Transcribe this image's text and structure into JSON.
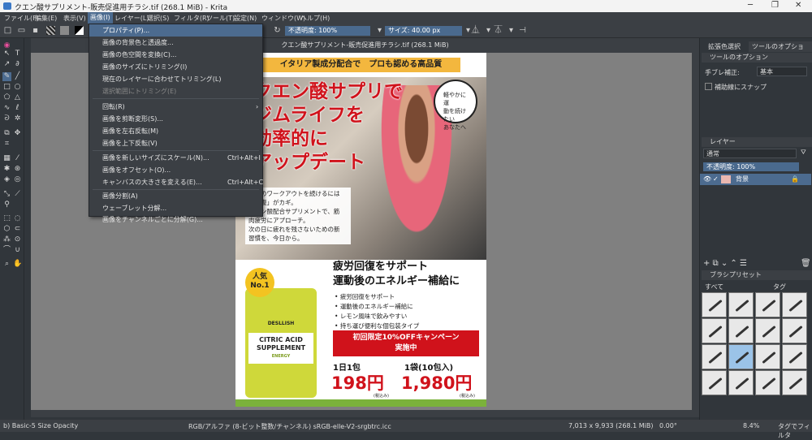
{
  "window": {
    "title": "クエン酸サプリメント-販売促進用チラシ.tif (268.1 MiB) - Krita"
  },
  "menubar": [
    "ファイル(F)",
    "編集(E)",
    "表示(V)",
    "画像(I)",
    "レイヤー(L)",
    "選択(S)",
    "フィルタ(R)",
    "ツール(T)",
    "設定(N)",
    "ウィンドウ(W)",
    "ヘルプ(H)"
  ],
  "toolbar": {
    "opacity": "不透明度: 100%",
    "size": "サイズ: 40.00 px"
  },
  "document_tab": "クエン酸サプリメント-販売促進用チラシ.tif (268.1 MiB)",
  "image_menu": [
    {
      "label": "プロパティ(P)...",
      "highlighted": true
    },
    {
      "label": "画像の背景色と透過度..."
    },
    {
      "label": "画像の色空間を変換(C)..."
    },
    {
      "label": "画像のサイズにトリミング(I)"
    },
    {
      "label": "現在のレイヤーに合わせてトリミング(L)"
    },
    {
      "label": "選択範囲にトリミング(E)",
      "disabled": true
    },
    {
      "label": "回転(R)",
      "submenu": true
    },
    {
      "label": "画像を剪断変形(S)..."
    },
    {
      "label": "画像を左右反転(M)"
    },
    {
      "label": "画像を上下反転(V)"
    },
    {
      "label": "画像を新しいサイズにスケール(N)...",
      "shortcut": "Ctrl+Alt+I"
    },
    {
      "label": "画像をオフセット(O)..."
    },
    {
      "label": "キャンバスの大きさを変える(E)...",
      "shortcut": "Ctrl+Alt+C"
    },
    {
      "label": "画像分割(A)"
    },
    {
      "label": "ウェーブレット分解..."
    },
    {
      "label": "画像をチャンネルごとに分解(G)..."
    }
  ],
  "flyer": {
    "banner": "イタリア製成分配合で　プロも認める高品質",
    "headline": [
      "クエン酸サプリで",
      "ジムライフを",
      "効率的に",
      "アップデート"
    ],
    "bubble": [
      "軽やかに運",
      "動を続けたい",
      "あなたへ"
    ],
    "body": [
      "毎日のワークアウトを続けるには",
      "「回復」がカギ。",
      "クエン酸配合サプリメントで、筋",
      "肉疲労にアプローチ。",
      "次の日に疲れを残さないための新",
      "習慣を、今日から。"
    ],
    "badge": [
      "人気",
      "No.1"
    ],
    "product_brand": "DESLLISH",
    "product_label": [
      "CITRIC ACID",
      "SUPPLEMENT",
      "ENERGY"
    ],
    "heading": [
      "疲労回復をサポート",
      "運動後のエネルギー補給に"
    ],
    "bullets": [
      "疲労回復をサポート",
      "運動後のエネルギー補給に",
      "レモン風味で飲みやすい",
      "持ち運び便利な個包装タイプ"
    ],
    "cta": [
      "初回限定10%OFFキャンペーン",
      "実施中"
    ],
    "price1_label": "1日1包",
    "price1": "198円",
    "price2_label": "1袋(10包入)",
    "price2": "1,980円",
    "tax": "(税込み)"
  },
  "right_dock": {
    "tabs": [
      "拡張色選択",
      "ツールのオプション"
    ],
    "tool_options_title": "ツールのオプション",
    "smoothing_label": "手ブレ補正:",
    "smoothing_value": "基本",
    "snap_label": "補助線にスナップ",
    "layers_title": "レイヤー",
    "blend_mode": "通常",
    "layer_opacity": "不透明度: 100%",
    "layer_name": "背景",
    "brush_presets_title": "ブラシプリセット",
    "brush_filter": "すべて",
    "brush_tag": "タグ"
  },
  "statusbar": {
    "brush": "b) Basic-5 Size Opacity",
    "colorspace": "RGB/アルファ (8-ビット整数/チャンネル)  sRGB-elle-V2-srgbtrc.icc",
    "dimensions": "7,013 x 9,933 (268.1 MiB)",
    "rotation": "0.00°",
    "zoom": "8.4%",
    "tag_filter": "タグでフィルタ"
  }
}
